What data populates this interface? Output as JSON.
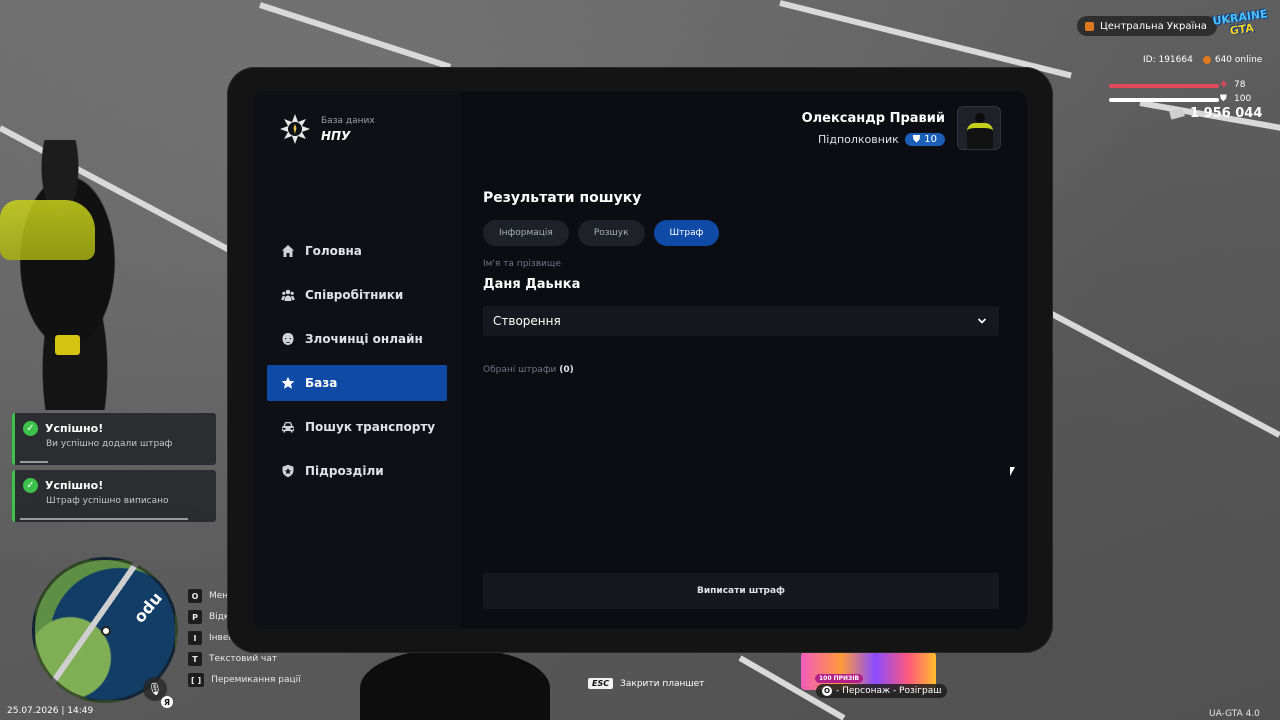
{
  "hud": {
    "region": "Центральна Україна",
    "game_logo_top": "UKRAINE",
    "game_logo_bottom": "GTA",
    "player_id": "ID: 191664",
    "online": "640 online",
    "health": 78,
    "armor": 100,
    "money": "1 956 044",
    "datetime": "25.07.2026 | 14:49",
    "version": "UA-GTA 4.0",
    "mic_lang": "Я",
    "hotkeys": [
      {
        "key": "O",
        "label": "Мені"
      },
      {
        "key": "P",
        "label": "Відк"
      },
      {
        "key": "I",
        "label": "Інвент"
      },
      {
        "key": "T",
        "label": "Текстовий чат"
      },
      {
        "key": "[ ]",
        "label": "Перемикання рації"
      }
    ],
    "esc_hint": {
      "key": "ESC",
      "label": "Закрити планшет"
    },
    "promo": {
      "badge": "100 ПРИЗІВ",
      "key": "O",
      "label": "- Персонаж - Розіграш"
    },
    "map_label": "odu"
  },
  "notifications": [
    {
      "title": "Успішно!",
      "text": "Ви успішно додали штраф",
      "progress": 0.14
    },
    {
      "title": "Успішно!",
      "text": "Штраф успішно виписано",
      "progress": 0.85
    }
  ],
  "tablet": {
    "brand_sub": "База даних",
    "brand_title": "НПУ",
    "user": {
      "name": "Олександр Правий",
      "rank": "Підполковник",
      "level": "10"
    },
    "nav": [
      {
        "label": "Головна",
        "icon": "home-icon",
        "active": false
      },
      {
        "label": "Співробітники",
        "icon": "users-icon",
        "active": false
      },
      {
        "label": "Злочинці онлайн",
        "icon": "mask-icon",
        "active": false
      },
      {
        "label": "База",
        "icon": "star-icon",
        "active": true
      },
      {
        "label": "Пошук транспорту",
        "icon": "car-icon",
        "active": false
      },
      {
        "label": "Підрозділи",
        "icon": "shield-icon",
        "active": false
      }
    ],
    "main": {
      "title": "Результати пошуку",
      "tabs": [
        {
          "label": "Інформація",
          "active": false
        },
        {
          "label": "Розшук",
          "active": false
        },
        {
          "label": "Штраф",
          "active": true
        }
      ],
      "name_label": "Ім'я та прізвище",
      "name_value": "Даня Дaьнка",
      "select_value": "Створення",
      "selected_label": "Обрані штрафи",
      "selected_count": "(0)",
      "submit_label": "Виписати штраф"
    }
  },
  "colors": {
    "accent": "#0f4aa6",
    "success": "#3cc24a",
    "health": "#e04b5a",
    "panel": "#0b0d12"
  }
}
